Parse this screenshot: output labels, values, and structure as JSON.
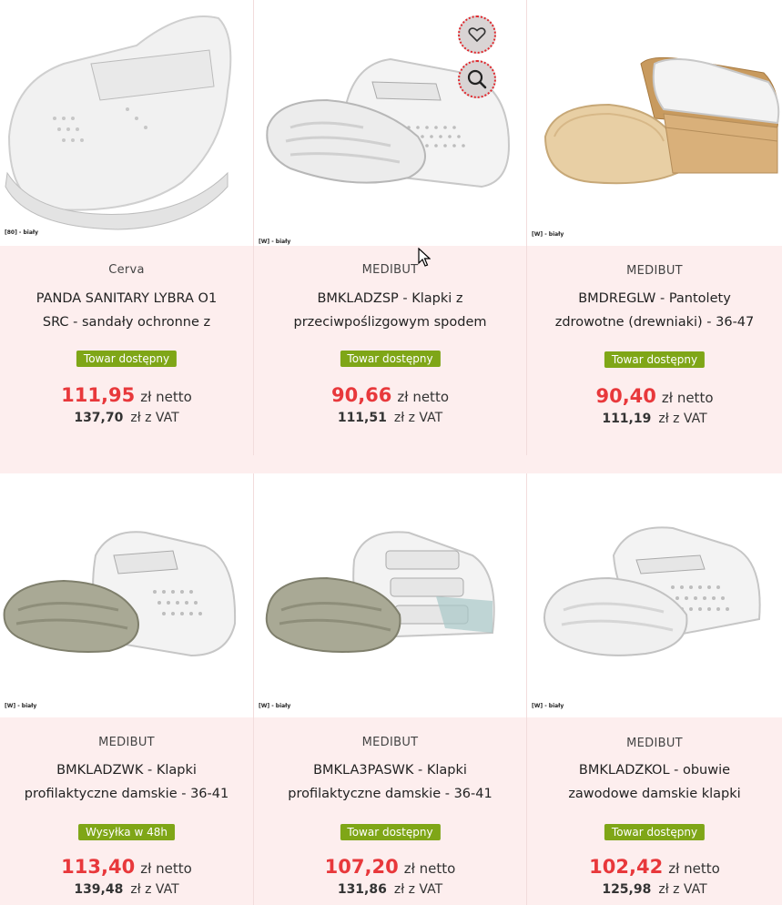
{
  "colors": {
    "price_red": "#e8383b",
    "badge_green": "#7fa617",
    "background": "#fdeeee"
  },
  "products": [
    {
      "caption": "[80] - biały",
      "brand": "Cerva",
      "title_line1": "PANDA SANITARY LYBRA O1",
      "title_line2": "SRC - sandały ochronne z",
      "badge": "Towar dostępny",
      "price_net": "111,95",
      "net_unit": "zł netto",
      "price_gross": "137,70",
      "gross_unit": "zł z VAT"
    },
    {
      "caption": "[W] - biały",
      "brand": "MEDIBUT",
      "title_line1": "BMKLADZSP - Klapki z",
      "title_line2": "przeciwpoślizgowym spodem",
      "badge": "Towar dostępny",
      "price_net": "90,66",
      "net_unit": "zł netto",
      "price_gross": "111,51",
      "gross_unit": "zł z VAT"
    },
    {
      "caption": "[W] - biały",
      "brand": "MEDIBUT",
      "title_line1": "BMDREGLW - Pantolety",
      "title_line2": "zdrowotne (drewniaki) - 36-47",
      "badge": "Towar dostępny",
      "price_net": "90,40",
      "net_unit": "zł netto",
      "price_gross": "111,19",
      "gross_unit": "zł z VAT"
    },
    {
      "caption": "[W] - biały",
      "brand": "MEDIBUT",
      "title_line1": "BMKLADZWK - Klapki",
      "title_line2": "profilaktyczne damskie - 36-41",
      "badge": "Wysyłka w 48h",
      "price_net": "113,40",
      "net_unit": "zł netto",
      "price_gross": "139,48",
      "gross_unit": "zł z VAT"
    },
    {
      "caption": "[W] - biały",
      "brand": "MEDIBUT",
      "title_line1": "BMKLA3PASWK - Klapki",
      "title_line2": "profilaktyczne damskie - 36-41",
      "badge": "Towar dostępny",
      "price_net": "107,20",
      "net_unit": "zł netto",
      "price_gross": "131,86",
      "gross_unit": "zł z VAT"
    },
    {
      "caption": "[W] - biały",
      "brand": "MEDIBUT",
      "title_line1": "BMKLADZKOL - obuwie",
      "title_line2": "zawodowe damskie klapki",
      "badge": "Towar dostępny",
      "price_net": "102,42",
      "net_unit": "zł netto",
      "price_gross": "125,98",
      "gross_unit": "zł z VAT"
    }
  ],
  "hover_actions": {
    "wishlist_icon": "heart-icon",
    "quickview_icon": "search-icon"
  }
}
